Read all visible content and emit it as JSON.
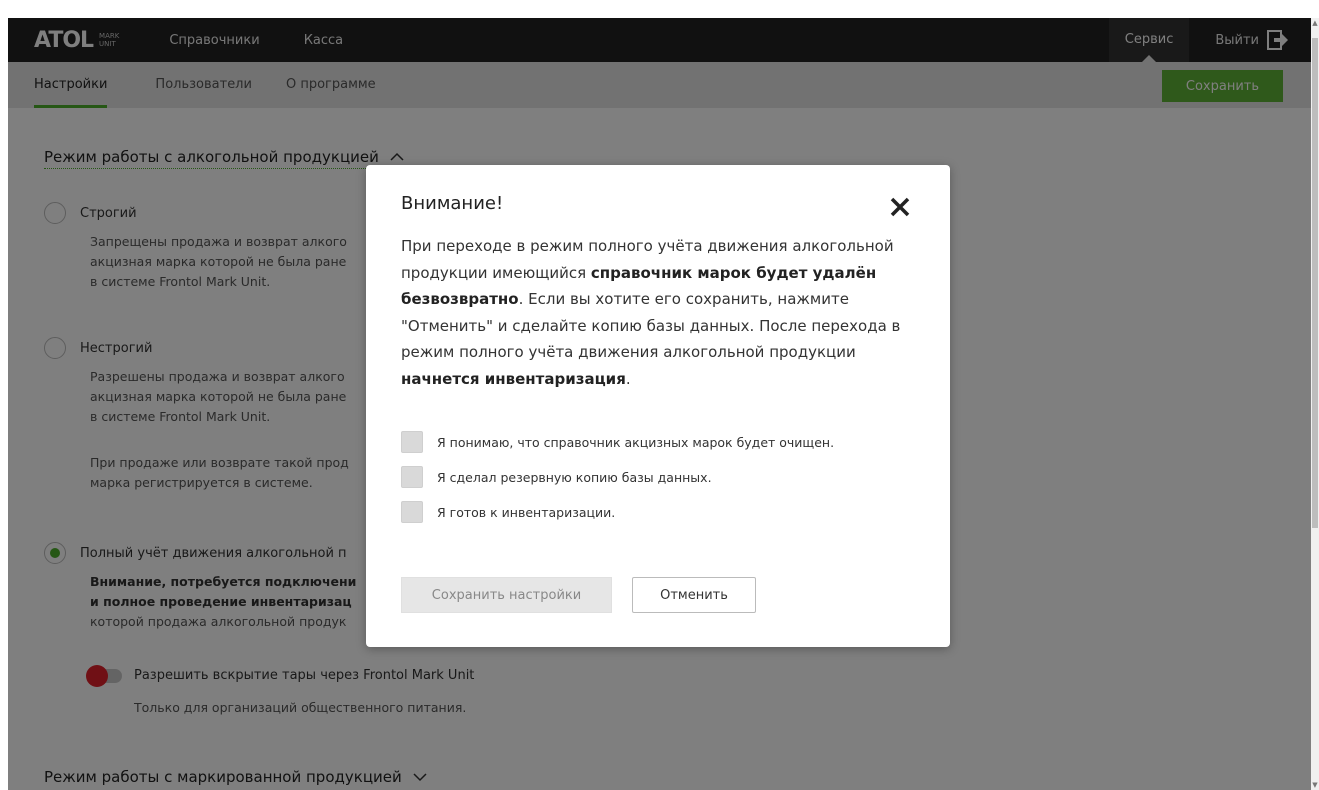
{
  "navbar": {
    "logo_main": "ATOL",
    "logo_sub_1": "MARK",
    "logo_sub_2": "UNIT",
    "items": [
      "Справочники",
      "Касса"
    ],
    "service_label": "Сервис",
    "logout_label": "Выйти"
  },
  "subnav": {
    "tabs": [
      "Настройки",
      "Пользователи",
      "О программе"
    ],
    "active_tab": "Настройки",
    "save_label": "Сохранить"
  },
  "settings": {
    "section1_title": "Режим работы с алкогольной продукцией",
    "section1_chevron": "^",
    "options": [
      {
        "label": "Строгий",
        "lines": [
          "Запрещены продажа и возврат алкого",
          "акцизная марка которой не была ране",
          "в системе Frontol Mark Unit."
        ]
      },
      {
        "label": "Нестрогий",
        "lines": [
          "Разрешены продажа и возврат алкого",
          "акцизная марка которой не была ране",
          "в системе Frontol Mark Unit.",
          "При продаже или возврате такой прод",
          "марка регистрируется в системе."
        ]
      },
      {
        "label": "Полный учёт движения алкогольной п",
        "bold_lines": [
          "Внимание, потребуется подключени",
          "и полное проведение инвентаризац"
        ],
        "lines": [
          "которой продажа алкогольной продук"
        ]
      }
    ],
    "selected_option": 2,
    "toggle_label": "Разрешить вскрытие тары через Frontol Mark Unit",
    "toggle_desc": "Только для организаций общественного питания.",
    "toggle_on": false,
    "section2_title": "Режим работы с маркированной продукцией",
    "section2_chevron": "v"
  },
  "modal": {
    "title": "Внимание!",
    "body_1": "При переходе в режим полного учёта движения алкогольной продукции имеющийся ",
    "body_bold_1": "справочник марок будет удалён безвозвратно",
    "body_2": ". Если вы хотите его сохранить, нажмите \"Отменить\" и сделайте копию базы данных. После перехода в режим полного учёта движения алкогольной продукции ",
    "body_bold_2": "начнется инвентаризация",
    "body_3": ".",
    "checkboxes": [
      "Я понимаю, что справочник акцизных марок будет очищен.",
      "Я сделал резервную копию базы данных.",
      "Я готов к инвентаризации."
    ],
    "save_settings_label": "Сохранить настройки",
    "cancel_label": "Отменить"
  },
  "colors": {
    "navbar": "#222222",
    "accent_green": "#5fb336",
    "toggle_red": "#e0202a"
  }
}
